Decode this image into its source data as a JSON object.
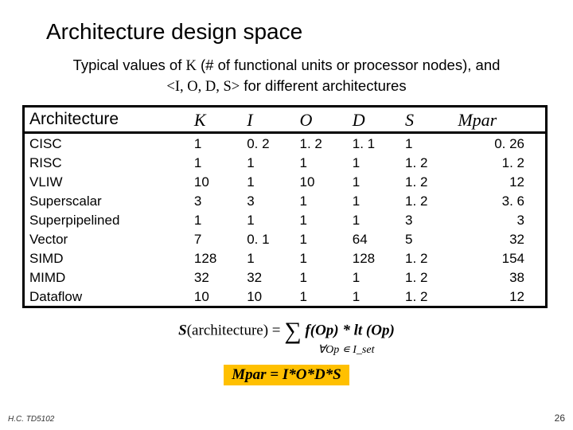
{
  "title": "Architecture design space",
  "subtitle": {
    "line1_pre": "Typical values of ",
    "K": "K",
    "line1_post": " (# of functional units or processor nodes), and",
    "line2_pre": "<",
    "line2_letters": "I, O, D, S",
    "line2_post": "> for different architectures"
  },
  "chart_data": {
    "type": "table",
    "columns": [
      "Architecture",
      "K",
      "I",
      "O",
      "D",
      "S",
      "Mpar"
    ],
    "rows": [
      {
        "arch": "CISC",
        "K": "1",
        "I": "0. 2",
        "O": "1. 2",
        "D": "1. 1",
        "S": "1",
        "Mpar": "0. 26"
      },
      {
        "arch": "RISC",
        "K": "1",
        "I": "1",
        "O": "1",
        "D": "1",
        "S": "1. 2",
        "Mpar": "1. 2"
      },
      {
        "arch": "VLIW",
        "K": "10",
        "I": "1",
        "O": "10",
        "D": "1",
        "S": "1. 2",
        "Mpar": "12"
      },
      {
        "arch": "Superscalar",
        "K": "3",
        "I": "3",
        "O": "1",
        "D": "1",
        "S": "1. 2",
        "Mpar": "3. 6"
      },
      {
        "arch": "Superpipelined",
        "K": "1",
        "I": "1",
        "O": "1",
        "D": "1",
        "S": "3",
        "Mpar": "3"
      },
      {
        "arch": "Vector",
        "K": "7",
        "I": "0. 1",
        "O": "1",
        "D": "64",
        "S": "5",
        "Mpar": "32"
      },
      {
        "arch": "SIMD",
        "K": "128",
        "I": "1",
        "O": "1",
        "D": "128",
        "S": "1. 2",
        "Mpar": "154"
      },
      {
        "arch": "MIMD",
        "K": "32",
        "I": "32",
        "O": "1",
        "D": "1",
        "S": "1. 2",
        "Mpar": "38"
      },
      {
        "arch": "Dataflow",
        "K": "10",
        "I": "10",
        "O": "1",
        "D": "1",
        "S": "1. 2",
        "Mpar": "12"
      }
    ]
  },
  "formula1": {
    "S_label": "S",
    "arch_label": "(architecture) = ",
    "sigma": "∑",
    "rhs1": " f(",
    "Op1": "Op",
    "rhs2": ") * lt (",
    "Op2": "Op",
    "rhs3": ")"
  },
  "formula_sub": {
    "forall": "∀",
    "text": "Op ∊ I_set"
  },
  "mpar_eq": "Mpar =  I*O*D*S",
  "footer_left": "H.C.  TD5102",
  "footer_right": "26"
}
